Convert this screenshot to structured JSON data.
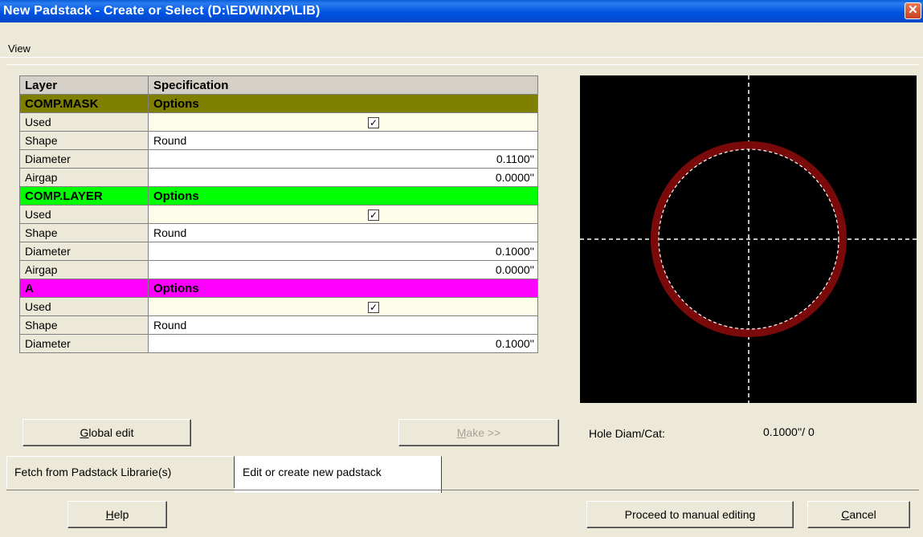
{
  "window": {
    "title": "New Padstack - Create or Select (D:\\EDWINXP\\LIB)",
    "close_glyph": "✕"
  },
  "menu": {
    "view": "View"
  },
  "grid": {
    "headers": {
      "layer": "Layer",
      "spec": "Specification"
    },
    "sections": [
      {
        "name": "COMP.MASK",
        "options": "Options",
        "color": "#7f7f00",
        "rows": [
          {
            "label": "Used",
            "check": "☑"
          },
          {
            "label": "Shape",
            "value": "Round"
          },
          {
            "label": "Diameter",
            "value": "0.1100''"
          },
          {
            "label": "Airgap",
            "value": "0.0000''"
          }
        ]
      },
      {
        "name": "COMP.LAYER",
        "options": "Options",
        "color": "#00ff00",
        "rows": [
          {
            "label": "Used"
          },
          {
            "label": "Shape",
            "value": "Round"
          },
          {
            "label": "Diameter",
            "value": "0.1000''"
          },
          {
            "label": "Airgap",
            "value": "0.0000''"
          }
        ]
      },
      {
        "name": "A",
        "options": "Options",
        "color": "#ff00ff",
        "rows": [
          {
            "label": "Used"
          },
          {
            "label": "Shape",
            "value": "Round"
          },
          {
            "label": "Diameter",
            "value": "0.1000''"
          }
        ]
      }
    ]
  },
  "buttons": {
    "global_edit_u": "G",
    "global_edit_rest": "lobal edit",
    "make_u": "M",
    "make_rest": "ake >>",
    "help_u": "H",
    "help_rest": "elp",
    "proceed": "Proceed to manual editing",
    "cancel_u": "C",
    "cancel_rest": "ancel"
  },
  "hole": {
    "label": "Hole Diam/Cat:",
    "value": "0.1000''/ 0"
  },
  "tabs": {
    "fetch": "Fetch from Padstack Librarie(s)",
    "edit": "Edit or create new padstack"
  },
  "preview": {
    "ring_color": "#7a0a0a",
    "crosshair_color": "#ffffff",
    "background": "#000000"
  }
}
